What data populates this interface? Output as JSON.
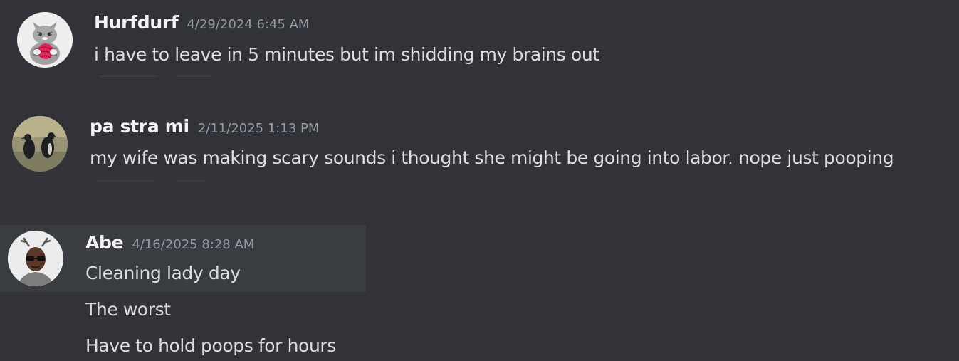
{
  "messages": [
    {
      "username": "Hurfdurf",
      "timestamp": "4/29/2024 6:45 AM",
      "lines": [
        "i have to leave in 5 minutes but im shidding my brains out"
      ],
      "avatar": "cat-with-yarn-avatar"
    },
    {
      "username": "pa stra mi",
      "timestamp": "2/11/2025 1:13 PM",
      "lines": [
        "my wife was making scary sounds i thought she might be going into labor.  nope just pooping"
      ],
      "avatar": "penguins-avatar"
    },
    {
      "username": "Abe",
      "timestamp": "4/16/2025 8:28 AM",
      "lines": [
        "Cleaning lady day",
        "The worst",
        "Have to hold poops for hours"
      ],
      "avatar": "man-sunglasses-avatar"
    }
  ],
  "colors": {
    "background": "#313338",
    "hover": "#393c41",
    "username": "#f2f3f5",
    "timestamp": "#949ba4",
    "text": "#dbdee1"
  }
}
